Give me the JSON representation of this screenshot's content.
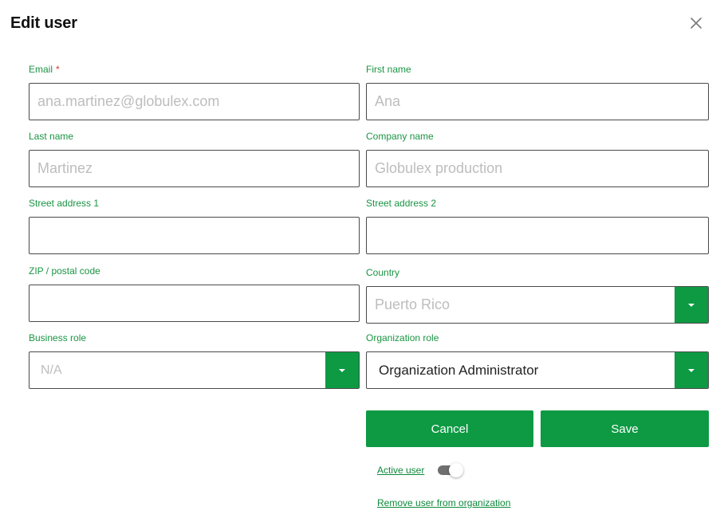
{
  "dialog": {
    "title": "Edit user",
    "close_icon": "close-icon"
  },
  "form": {
    "email": {
      "label": "Email",
      "required_mark": "*",
      "placeholder": "ana.martinez@globulex.com"
    },
    "first_name": {
      "label": "First name",
      "placeholder": "Ana"
    },
    "last_name": {
      "label": "Last name",
      "placeholder": "Martinez"
    },
    "company_name": {
      "label": "Company name",
      "placeholder": "Globulex production"
    },
    "street_address_1": {
      "label": "Street address 1",
      "placeholder": ""
    },
    "street_address_2": {
      "label": "Street address 2",
      "placeholder": ""
    },
    "zip": {
      "label": "ZIP / postal code",
      "placeholder": ""
    },
    "country": {
      "label": "Country",
      "value": "Puerto Rico"
    },
    "business_role": {
      "label": "Business role",
      "value": "N/A"
    },
    "organization_role": {
      "label": "Organization role",
      "value": "Organization Administrator"
    }
  },
  "actions": {
    "cancel_label": "Cancel",
    "save_label": "Save",
    "active_user_label": "Active user",
    "active_user_on": false,
    "remove_label": "Remove user from organization"
  },
  "colors": {
    "accent": "#0d9a43",
    "label_green": "#1a9443",
    "required_red": "#e0332b"
  },
  "icons": {
    "dropdown": "chevron-down-icon",
    "close": "close-icon"
  }
}
